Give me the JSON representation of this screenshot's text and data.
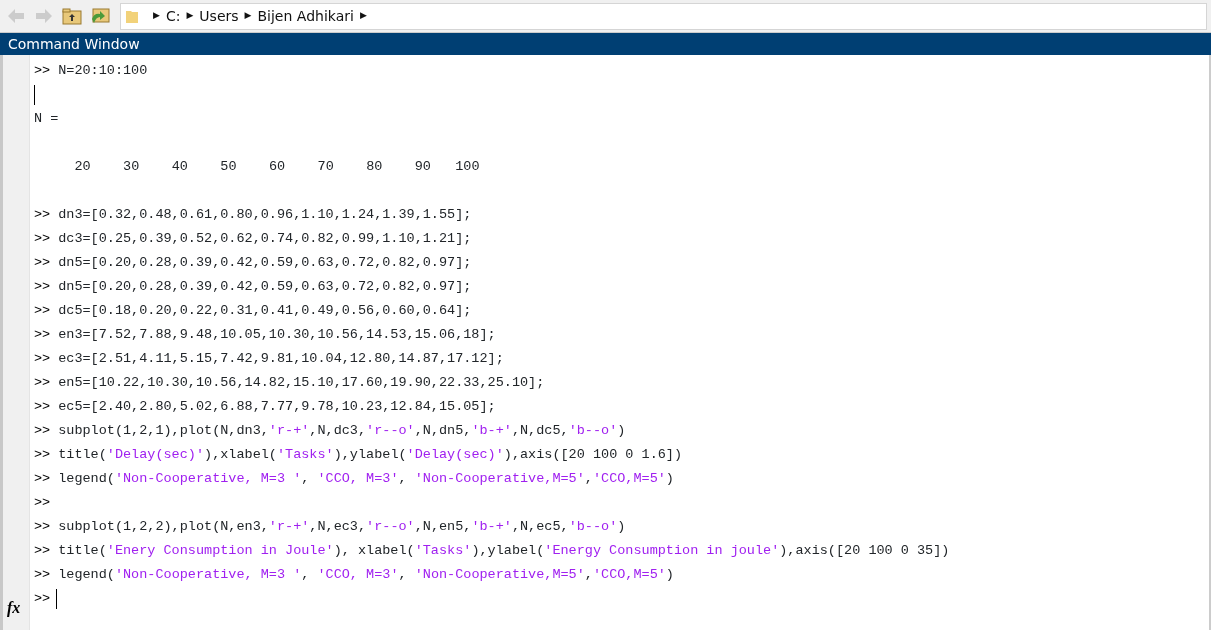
{
  "toolbar": {
    "buttons": [
      {
        "kind": "back",
        "disabled": true
      },
      {
        "kind": "forward",
        "disabled": true
      },
      {
        "kind": "up",
        "disabled": false
      },
      {
        "kind": "browse",
        "disabled": false
      }
    ],
    "breadcrumb": [
      {
        "kind": "separator",
        "text": "▶"
      },
      {
        "kind": "folder",
        "text": "C:"
      },
      {
        "kind": "separator",
        "text": "▶"
      },
      {
        "kind": "folder",
        "text": "Users"
      },
      {
        "kind": "separator",
        "text": "▶"
      },
      {
        "kind": "folder",
        "text": "Bijen Adhikari"
      },
      {
        "kind": "separator",
        "text": "▶"
      }
    ]
  },
  "window": {
    "title": "Command Window"
  },
  "console": {
    "prompt": ">>",
    "function_button": "fx",
    "lines": [
      {
        "kind": "command",
        "segments": [
          {
            "kind": "code",
            "text": "N=20:10:100"
          }
        ]
      },
      {
        "kind": "caret"
      },
      {
        "kind": "output",
        "text": "N ="
      },
      {
        "kind": "blank"
      },
      {
        "kind": "output",
        "text": "     20    30    40    50    60    70    80    90   100"
      },
      {
        "kind": "blank"
      },
      {
        "kind": "command",
        "segments": [
          {
            "kind": "code",
            "text": "dn3=[0.32,0.48,0.61,0.80,0.96,1.10,1.24,1.39,1.55];"
          }
        ]
      },
      {
        "kind": "command",
        "segments": [
          {
            "kind": "code",
            "text": "dc3=[0.25,0.39,0.52,0.62,0.74,0.82,0.99,1.10,1.21];"
          }
        ]
      },
      {
        "kind": "command",
        "segments": [
          {
            "kind": "code",
            "text": "dn5=[0.20,0.28,0.39,0.42,0.59,0.63,0.72,0.82,0.97];"
          }
        ]
      },
      {
        "kind": "command",
        "segments": [
          {
            "kind": "code",
            "text": "dn5=[0.20,0.28,0.39,0.42,0.59,0.63,0.72,0.82,0.97];"
          }
        ]
      },
      {
        "kind": "command",
        "segments": [
          {
            "kind": "code",
            "text": "dc5=[0.18,0.20,0.22,0.31,0.41,0.49,0.56,0.60,0.64];"
          }
        ]
      },
      {
        "kind": "command",
        "segments": [
          {
            "kind": "code",
            "text": "en3=[7.52,7.88,9.48,10.05,10.30,10.56,14.53,15.06,18];"
          }
        ]
      },
      {
        "kind": "command",
        "segments": [
          {
            "kind": "code",
            "text": "ec3=[2.51,4.11,5.15,7.42,9.81,10.04,12.80,14.87,17.12];"
          }
        ]
      },
      {
        "kind": "command",
        "segments": [
          {
            "kind": "code",
            "text": "en5=[10.22,10.30,10.56,14.82,15.10,17.60,19.90,22.33,25.10];"
          }
        ]
      },
      {
        "kind": "command",
        "segments": [
          {
            "kind": "code",
            "text": "ec5=[2.40,2.80,5.02,6.88,7.77,9.78,10.23,12.84,15.05];"
          }
        ]
      },
      {
        "kind": "command",
        "segments": [
          {
            "kind": "code",
            "text": "subplot(1,2,1),plot(N,dn3,"
          },
          {
            "kind": "string",
            "text": "'r-+'"
          },
          {
            "kind": "code",
            "text": ",N,dc3,"
          },
          {
            "kind": "string",
            "text": "'r--o'"
          },
          {
            "kind": "code",
            "text": ",N,dn5,"
          },
          {
            "kind": "string",
            "text": "'b-+'"
          },
          {
            "kind": "code",
            "text": ",N,dc5,"
          },
          {
            "kind": "string",
            "text": "'b--o'"
          },
          {
            "kind": "code",
            "text": ")"
          }
        ]
      },
      {
        "kind": "command",
        "segments": [
          {
            "kind": "code",
            "text": "title("
          },
          {
            "kind": "string",
            "text": "'Delay(sec)'"
          },
          {
            "kind": "code",
            "text": "),xlabel("
          },
          {
            "kind": "string",
            "text": "'Tasks'"
          },
          {
            "kind": "code",
            "text": "),ylabel("
          },
          {
            "kind": "string",
            "text": "'Delay(sec)'"
          },
          {
            "kind": "code",
            "text": "),axis([20 100 0 1.6])"
          }
        ]
      },
      {
        "kind": "command",
        "segments": [
          {
            "kind": "code",
            "text": "legend("
          },
          {
            "kind": "string",
            "text": "'Non-Cooperative, M=3 '"
          },
          {
            "kind": "code",
            "text": ", "
          },
          {
            "kind": "string",
            "text": "'CCO, M=3'"
          },
          {
            "kind": "code",
            "text": ", "
          },
          {
            "kind": "string",
            "text": "'Non-Cooperative,M=5'"
          },
          {
            "kind": "code",
            "text": ","
          },
          {
            "kind": "string",
            "text": "'CCO,M=5'"
          },
          {
            "kind": "code",
            "text": ")"
          }
        ]
      },
      {
        "kind": "prompt"
      },
      {
        "kind": "command",
        "segments": [
          {
            "kind": "code",
            "text": "subplot(1,2,2),plot(N,en3,"
          },
          {
            "kind": "string",
            "text": "'r-+'"
          },
          {
            "kind": "code",
            "text": ",N,ec3,"
          },
          {
            "kind": "string",
            "text": "'r--o'"
          },
          {
            "kind": "code",
            "text": ",N,en5,"
          },
          {
            "kind": "string",
            "text": "'b-+'"
          },
          {
            "kind": "code",
            "text": ",N,ec5,"
          },
          {
            "kind": "string",
            "text": "'b--o'"
          },
          {
            "kind": "code",
            "text": ")"
          }
        ]
      },
      {
        "kind": "command",
        "segments": [
          {
            "kind": "code",
            "text": "title("
          },
          {
            "kind": "string",
            "text": "'Enery Consumption in Joule'"
          },
          {
            "kind": "code",
            "text": "), xlabel("
          },
          {
            "kind": "string",
            "text": "'Tasks'"
          },
          {
            "kind": "code",
            "text": "),ylabel("
          },
          {
            "kind": "string",
            "text": "'Energy Consumption in joule'"
          },
          {
            "kind": "code",
            "text": "),axis([20 100 0 35])"
          }
        ]
      },
      {
        "kind": "command",
        "segments": [
          {
            "kind": "code",
            "text": "legend("
          },
          {
            "kind": "string",
            "text": "'Non-Cooperative, M=3 '"
          },
          {
            "kind": "code",
            "text": ", "
          },
          {
            "kind": "string",
            "text": "'CCO, M=3'"
          },
          {
            "kind": "code",
            "text": ", "
          },
          {
            "kind": "string",
            "text": "'Non-Cooperative,M=5'"
          },
          {
            "kind": "code",
            "text": ","
          },
          {
            "kind": "string",
            "text": "'CCO,M=5'"
          },
          {
            "kind": "code",
            "text": ")"
          }
        ]
      },
      {
        "kind": "active"
      }
    ]
  }
}
